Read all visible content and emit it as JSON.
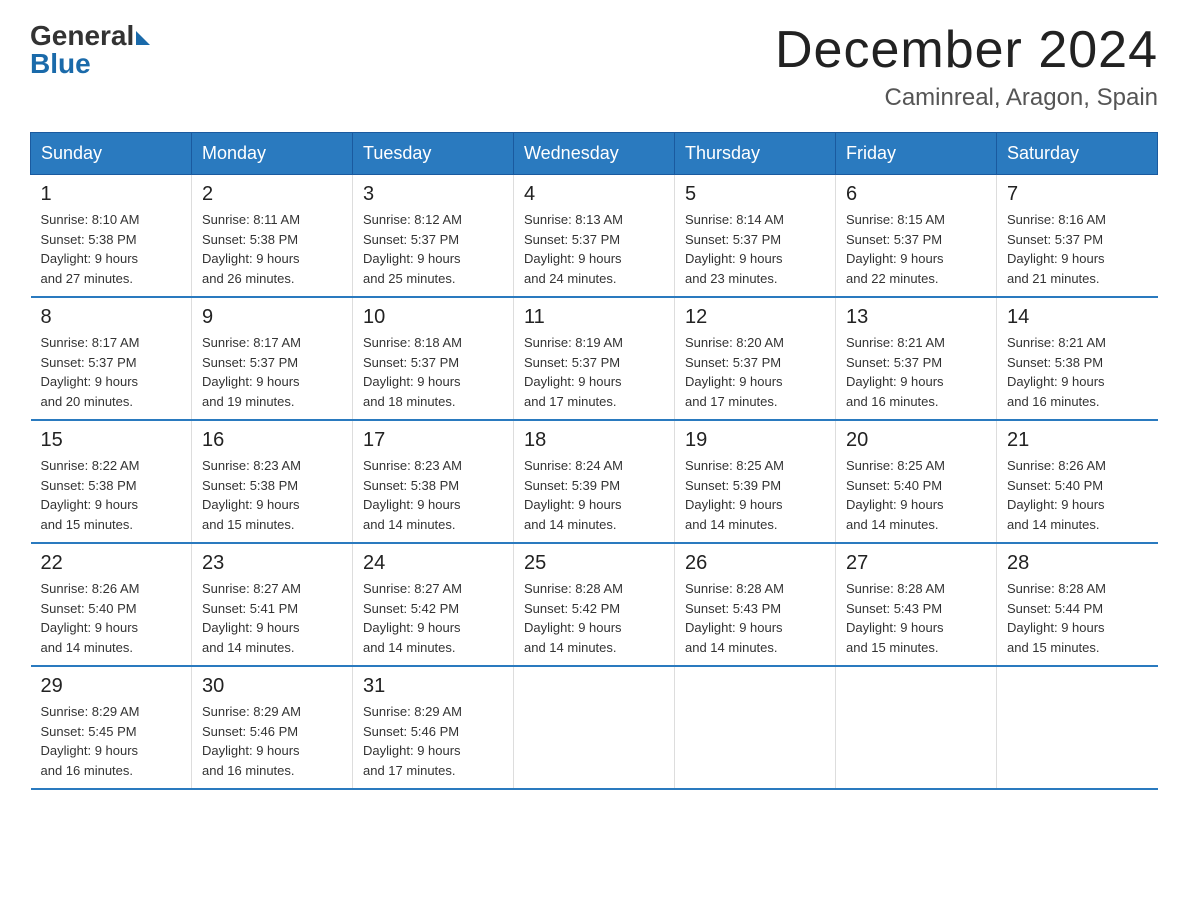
{
  "logo": {
    "general": "General",
    "blue": "Blue"
  },
  "header": {
    "month": "December 2024",
    "location": "Caminreal, Aragon, Spain"
  },
  "days_of_week": [
    "Sunday",
    "Monday",
    "Tuesday",
    "Wednesday",
    "Thursday",
    "Friday",
    "Saturday"
  ],
  "weeks": [
    [
      {
        "day": "1",
        "sunrise": "8:10 AM",
        "sunset": "5:38 PM",
        "daylight": "9 hours and 27 minutes."
      },
      {
        "day": "2",
        "sunrise": "8:11 AM",
        "sunset": "5:38 PM",
        "daylight": "9 hours and 26 minutes."
      },
      {
        "day": "3",
        "sunrise": "8:12 AM",
        "sunset": "5:37 PM",
        "daylight": "9 hours and 25 minutes."
      },
      {
        "day": "4",
        "sunrise": "8:13 AM",
        "sunset": "5:37 PM",
        "daylight": "9 hours and 24 minutes."
      },
      {
        "day": "5",
        "sunrise": "8:14 AM",
        "sunset": "5:37 PM",
        "daylight": "9 hours and 23 minutes."
      },
      {
        "day": "6",
        "sunrise": "8:15 AM",
        "sunset": "5:37 PM",
        "daylight": "9 hours and 22 minutes."
      },
      {
        "day": "7",
        "sunrise": "8:16 AM",
        "sunset": "5:37 PM",
        "daylight": "9 hours and 21 minutes."
      }
    ],
    [
      {
        "day": "8",
        "sunrise": "8:17 AM",
        "sunset": "5:37 PM",
        "daylight": "9 hours and 20 minutes."
      },
      {
        "day": "9",
        "sunrise": "8:17 AM",
        "sunset": "5:37 PM",
        "daylight": "9 hours and 19 minutes."
      },
      {
        "day": "10",
        "sunrise": "8:18 AM",
        "sunset": "5:37 PM",
        "daylight": "9 hours and 18 minutes."
      },
      {
        "day": "11",
        "sunrise": "8:19 AM",
        "sunset": "5:37 PM",
        "daylight": "9 hours and 17 minutes."
      },
      {
        "day": "12",
        "sunrise": "8:20 AM",
        "sunset": "5:37 PM",
        "daylight": "9 hours and 17 minutes."
      },
      {
        "day": "13",
        "sunrise": "8:21 AM",
        "sunset": "5:37 PM",
        "daylight": "9 hours and 16 minutes."
      },
      {
        "day": "14",
        "sunrise": "8:21 AM",
        "sunset": "5:38 PM",
        "daylight": "9 hours and 16 minutes."
      }
    ],
    [
      {
        "day": "15",
        "sunrise": "8:22 AM",
        "sunset": "5:38 PM",
        "daylight": "9 hours and 15 minutes."
      },
      {
        "day": "16",
        "sunrise": "8:23 AM",
        "sunset": "5:38 PM",
        "daylight": "9 hours and 15 minutes."
      },
      {
        "day": "17",
        "sunrise": "8:23 AM",
        "sunset": "5:38 PM",
        "daylight": "9 hours and 14 minutes."
      },
      {
        "day": "18",
        "sunrise": "8:24 AM",
        "sunset": "5:39 PM",
        "daylight": "9 hours and 14 minutes."
      },
      {
        "day": "19",
        "sunrise": "8:25 AM",
        "sunset": "5:39 PM",
        "daylight": "9 hours and 14 minutes."
      },
      {
        "day": "20",
        "sunrise": "8:25 AM",
        "sunset": "5:40 PM",
        "daylight": "9 hours and 14 minutes."
      },
      {
        "day": "21",
        "sunrise": "8:26 AM",
        "sunset": "5:40 PM",
        "daylight": "9 hours and 14 minutes."
      }
    ],
    [
      {
        "day": "22",
        "sunrise": "8:26 AM",
        "sunset": "5:40 PM",
        "daylight": "9 hours and 14 minutes."
      },
      {
        "day": "23",
        "sunrise": "8:27 AM",
        "sunset": "5:41 PM",
        "daylight": "9 hours and 14 minutes."
      },
      {
        "day": "24",
        "sunrise": "8:27 AM",
        "sunset": "5:42 PM",
        "daylight": "9 hours and 14 minutes."
      },
      {
        "day": "25",
        "sunrise": "8:28 AM",
        "sunset": "5:42 PM",
        "daylight": "9 hours and 14 minutes."
      },
      {
        "day": "26",
        "sunrise": "8:28 AM",
        "sunset": "5:43 PM",
        "daylight": "9 hours and 14 minutes."
      },
      {
        "day": "27",
        "sunrise": "8:28 AM",
        "sunset": "5:43 PM",
        "daylight": "9 hours and 15 minutes."
      },
      {
        "day": "28",
        "sunrise": "8:28 AM",
        "sunset": "5:44 PM",
        "daylight": "9 hours and 15 minutes."
      }
    ],
    [
      {
        "day": "29",
        "sunrise": "8:29 AM",
        "sunset": "5:45 PM",
        "daylight": "9 hours and 16 minutes."
      },
      {
        "day": "30",
        "sunrise": "8:29 AM",
        "sunset": "5:46 PM",
        "daylight": "9 hours and 16 minutes."
      },
      {
        "day": "31",
        "sunrise": "8:29 AM",
        "sunset": "5:46 PM",
        "daylight": "9 hours and 17 minutes."
      },
      null,
      null,
      null,
      null
    ]
  ],
  "labels": {
    "sunrise": "Sunrise:",
    "sunset": "Sunset:",
    "daylight": "Daylight:"
  }
}
